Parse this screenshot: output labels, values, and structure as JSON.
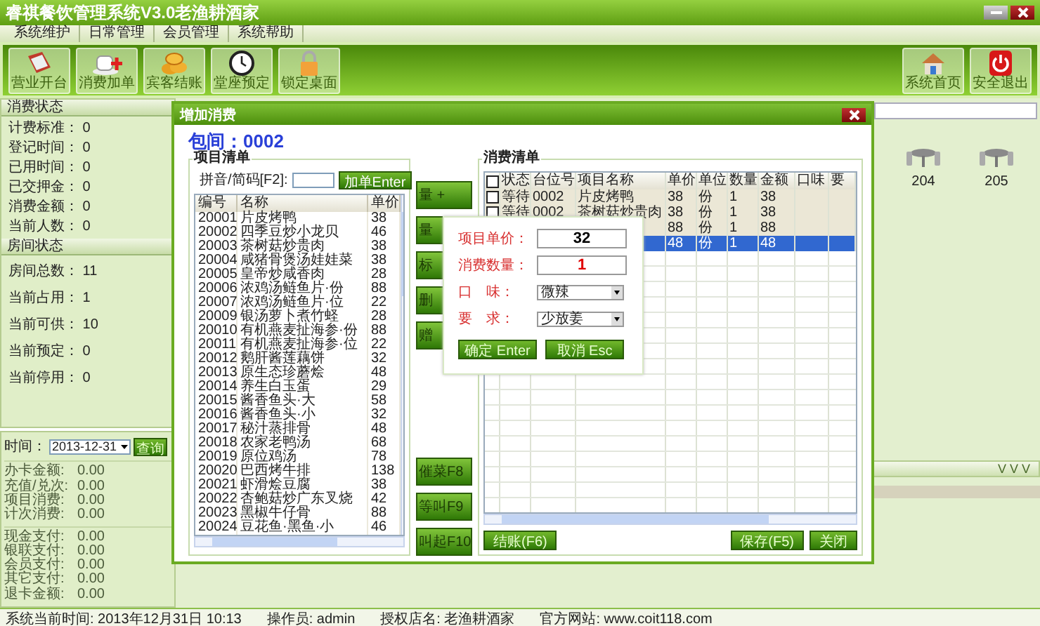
{
  "window": {
    "title": "睿祺餐饮管理系统V3.0老渔耕酒家"
  },
  "menu": [
    "系统维护",
    "日常管理",
    "会员管理",
    "系统帮助"
  ],
  "toolbar": {
    "left": [
      {
        "label": "营业开台",
        "kind": "book"
      },
      {
        "label": "消费加单",
        "kind": "cup"
      },
      {
        "label": "宾客结账",
        "kind": "coins"
      },
      {
        "label": "堂座预定",
        "kind": "clock"
      },
      {
        "label": "锁定桌面",
        "kind": "lock"
      }
    ],
    "right": [
      {
        "label": "系统首页",
        "kind": "home"
      },
      {
        "label": "安全退出",
        "kind": "power"
      }
    ]
  },
  "consumption_status": {
    "title": "消费状态",
    "items": [
      {
        "label": "计费标准：",
        "value": "0"
      },
      {
        "label": "登记时间：",
        "value": "0"
      },
      {
        "label": "已用时间：",
        "value": "0"
      },
      {
        "label": "已交押金：",
        "value": "0"
      },
      {
        "label": "消费金额：",
        "value": "0"
      },
      {
        "label": "当前人数：",
        "value": "0"
      }
    ]
  },
  "room_status": {
    "title": "房间状态",
    "items": [
      {
        "label": "房间总数：",
        "value": "11"
      },
      {
        "label": "当前占用：",
        "value": "1"
      },
      {
        "label": "当前可供：",
        "value": "10"
      },
      {
        "label": "当前预定：",
        "value": "0"
      },
      {
        "label": "当前停用：",
        "value": "0"
      }
    ]
  },
  "query": {
    "label": "时间：",
    "date": "2013-12-31",
    "button": "查询"
  },
  "summary_groups": [
    [
      {
        "label": "办卡金额:",
        "value": "0.00"
      },
      {
        "label": "充值/兑次:",
        "value": "0.00"
      },
      {
        "label": "项目消费:",
        "value": "0.00"
      },
      {
        "label": "计次消费:",
        "value": "0.00"
      }
    ],
    [
      {
        "label": "现金支付:",
        "value": "0.00"
      },
      {
        "label": "银联支付:",
        "value": "0.00"
      },
      {
        "label": "会员支付:",
        "value": "0.00"
      },
      {
        "label": "其它支付:",
        "value": "0.00"
      },
      {
        "label": "退卡金额:",
        "value": "0.00"
      }
    ]
  ],
  "tables": [
    {
      "label": "204"
    },
    {
      "label": "205"
    }
  ],
  "bottom_panel": {
    "toggle": "V V V"
  },
  "dialog": {
    "title": "增加消费",
    "room": "包间：0002",
    "item_list": {
      "title": "项目清单",
      "search_label": "拼音/简码[F2]:",
      "add_button": "加单Enter",
      "columns": [
        "编号",
        "名称",
        "单价"
      ],
      "rows": [
        [
          "20001",
          "片皮烤鸭",
          "38"
        ],
        [
          "20002",
          "四季豆炒小龙贝",
          "46"
        ],
        [
          "20003",
          "茶树菇炒贵肉",
          "38"
        ],
        [
          "20004",
          "咸猪骨煲汤娃娃菜",
          "38"
        ],
        [
          "20005",
          "皇帝炒咸香肉",
          "28"
        ],
        [
          "20006",
          "浓鸡汤鲢鱼片·份",
          "88"
        ],
        [
          "20007",
          "浓鸡汤鲢鱼片·位",
          "22"
        ],
        [
          "20009",
          "银汤萝卜煮竹蛏",
          "28"
        ],
        [
          "20010",
          "有机燕麦扯海参·份",
          "88"
        ],
        [
          "20011",
          "有机燕麦扯海参·位",
          "22"
        ],
        [
          "20012",
          "鹅肝酱莲藕饼",
          "32"
        ],
        [
          "20013",
          "原生态珍蘑烩",
          "48"
        ],
        [
          "20014",
          "养生白玉蛋",
          "29"
        ],
        [
          "20015",
          "酱香鱼头·大",
          "58"
        ],
        [
          "20016",
          "酱香鱼头·小",
          "32"
        ],
        [
          "20017",
          "秘汁蒸排骨",
          "48"
        ],
        [
          "20018",
          "农家老鸭汤",
          "68"
        ],
        [
          "20019",
          "原位鸡汤",
          "78"
        ],
        [
          "20020",
          "巴西烤牛排",
          "138"
        ],
        [
          "20021",
          "虾滑烩豆腐",
          "38"
        ],
        [
          "20022",
          "杏鲍菇炒广东叉烧",
          "42"
        ],
        [
          "20023",
          "黑椒牛仔骨",
          "88"
        ],
        [
          "20024",
          "豆花鱼·黑鱼·小",
          "46"
        ]
      ]
    },
    "side_buttons_top": [
      "量 +",
      "量",
      "标",
      "删",
      "赠"
    ],
    "side_buttons_bottom": [
      "催菜F8",
      "等叫F9",
      "叫起F10"
    ],
    "order_list": {
      "title": "消费清单",
      "header_checked": false,
      "columns": [
        "状态",
        "台位号",
        "项目名称",
        "单价",
        "单位",
        "数量",
        "金额",
        "口味",
        "要"
      ],
      "rows": [
        {
          "checked": false,
          "selected": false,
          "cells": [
            "等待",
            "0002",
            "片皮烤鸭",
            "38",
            "份",
            "1",
            "38",
            null,
            null
          ]
        },
        {
          "checked": false,
          "selected": false,
          "cells": [
            "等待",
            "0002",
            "茶树菇炒贵肉",
            "38",
            "份",
            "1",
            "38",
            null,
            null
          ]
        },
        {
          "selected": false,
          "cells": [
            null,
            null,
            null,
            "88",
            "份",
            "1",
            "88",
            null,
            null
          ]
        },
        {
          "selected": true,
          "cells": [
            null,
            null,
            null,
            "48",
            "份",
            "1",
            "48",
            null,
            null
          ]
        }
      ]
    },
    "footer_left": [
      "结账(F6)"
    ],
    "footer_right": [
      "保存(F5)",
      "关闭"
    ],
    "popup": {
      "fields": [
        {
          "kind": "text",
          "label": "项目单价：",
          "value": "32",
          "color": "#000000"
        },
        {
          "kind": "text",
          "label": "消费数量：",
          "value": "1",
          "color": "#e00000"
        },
        {
          "kind": "select",
          "label": "口　味：",
          "value": "微辣"
        },
        {
          "kind": "select",
          "label": "要　求：",
          "value": "少放姜"
        }
      ],
      "buttons": [
        "确定 Enter",
        "取消 Esc"
      ]
    }
  },
  "status_bar": [
    {
      "label": "系统当前时间:",
      "value": "2013年12月31日 10:13"
    },
    {
      "label": "操作员:",
      "value": "admin"
    },
    {
      "label": "授权店名:",
      "value": "老渔耕酒家"
    },
    {
      "label": "官方网站:",
      "value": "www.coit118.com"
    }
  ]
}
